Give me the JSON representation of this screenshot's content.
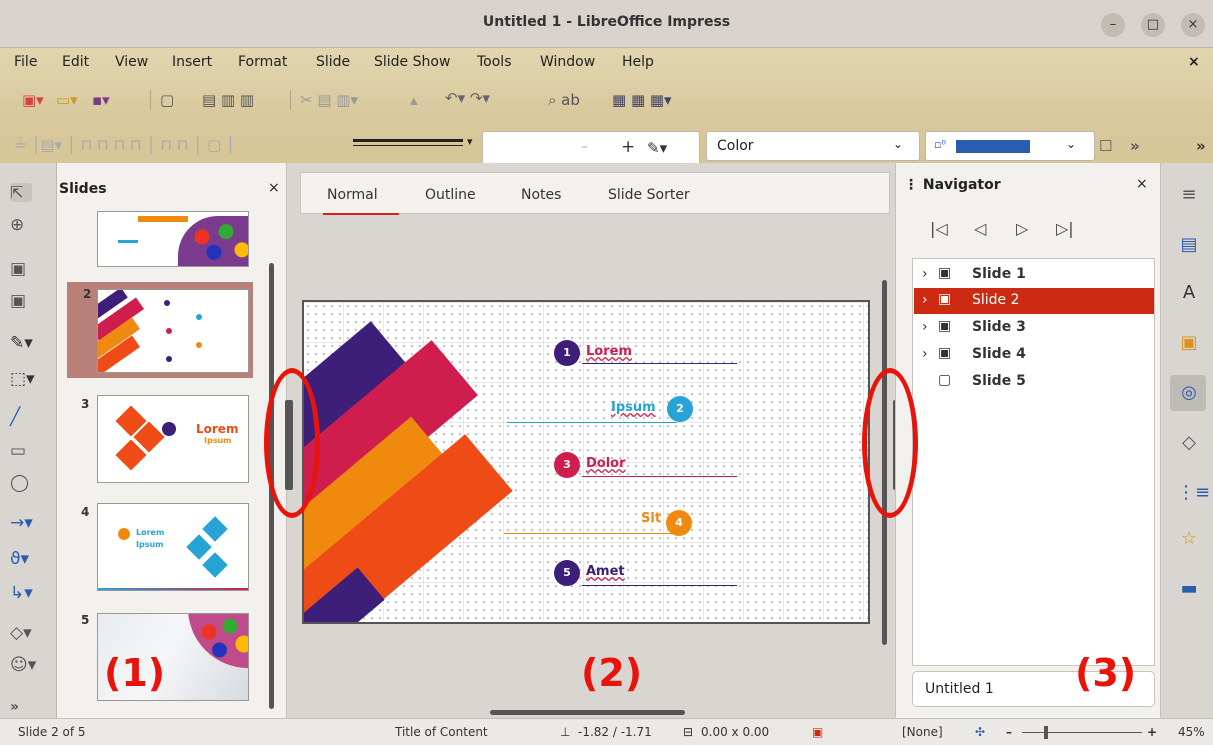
{
  "window": {
    "title": "Untitled 1 - LibreOffice Impress"
  },
  "menubar": {
    "items": [
      "File",
      "Edit",
      "View",
      "Insert",
      "Format",
      "Slide",
      "Slide Show",
      "Tools",
      "Window",
      "Help"
    ],
    "close": "×"
  },
  "toolbar": {
    "color_field": "Color",
    "more": "»"
  },
  "slides_pane": {
    "title": "Slides",
    "close": "×",
    "numbers": [
      "2",
      "3",
      "4",
      "5"
    ],
    "thumb3_title": "Lorem",
    "thumb3_sub": "Ipsum",
    "thumb4_title": "Lorem",
    "thumb4_sub": "Ipsum"
  },
  "view_tabs": [
    "Normal",
    "Outline",
    "Notes",
    "Slide Sorter"
  ],
  "slide": {
    "items": [
      {
        "num": "1",
        "label": "Lorem"
      },
      {
        "num": "2",
        "label": "Ipsum"
      },
      {
        "num": "3",
        "label": "Dolor"
      },
      {
        "num": "4",
        "label": "Sit"
      },
      {
        "num": "5",
        "label": "Amet"
      }
    ]
  },
  "navigator": {
    "title": "Navigator",
    "close": "×",
    "slides": [
      "Slide 1",
      "Slide 2",
      "Slide 3",
      "Slide 4",
      "Slide 5"
    ],
    "selected": "Slide 2",
    "document": "Untitled 1"
  },
  "callouts": {
    "left": "(1)",
    "center": "(2)",
    "right": "(3)"
  },
  "status": {
    "slide": "Slide 2 of 5",
    "layout": "Title of Content",
    "position": "-1.82 / -1.71",
    "size": "0.00 x 0.00",
    "lang": "[None]",
    "zoom": "45%"
  },
  "colors": {
    "selected_row": "#cc2a12",
    "accent_red": "#e8140c",
    "item1": "#3d1f7a",
    "item2": "#27a3d6",
    "item3": "#cf1e4e",
    "item4": "#f08a0e",
    "item5": "#3d1f7a"
  }
}
